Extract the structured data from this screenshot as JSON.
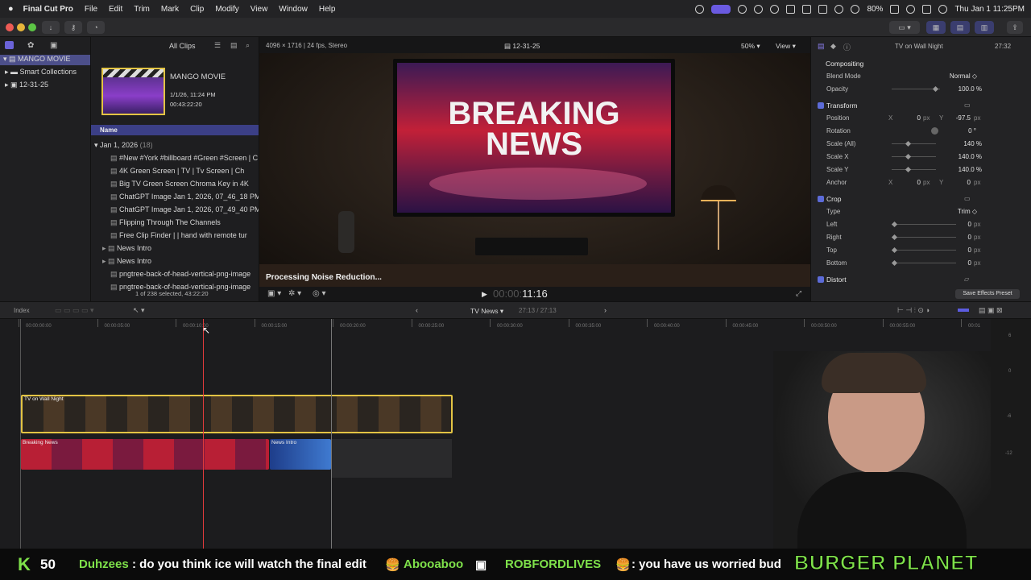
{
  "menubar": {
    "app": "Final Cut Pro",
    "items": [
      "File",
      "Edit",
      "Trim",
      "Mark",
      "Clip",
      "Modify",
      "View",
      "Window",
      "Help"
    ],
    "battery": "80%",
    "datetime": "Thu Jan 1  11:25PM"
  },
  "library": {
    "root": "MANGO MOVIE",
    "items": [
      "Smart Collections",
      "12-31-25"
    ]
  },
  "browser": {
    "filter": "All Clips",
    "project_title": "MANGO MOVIE",
    "project_date": "1/1/26, 11:24 PM",
    "project_duration": "00:43:22:20",
    "column": "Name",
    "group": "Jan 1, 2026",
    "group_count": "(18)",
    "clips": [
      "#New #York #billboard #Green #Screen | C",
      "4K Green Screen  |  TV  |  Tv Screen  |  Ch",
      "Big TV Green Screen Chroma Key in 4K",
      "ChatGPT Image Jan 1, 2026, 07_46_18 PM",
      "ChatGPT Image Jan 1, 2026, 07_49_40 PM",
      "Flipping Through The Channels",
      "Free Clip Finder  |  |  hand with remote tur",
      "News Intro",
      "News Intro",
      "pngtree-back-of-head-vertical-png-image",
      "pngtree-back-of-head-vertical-png-image"
    ],
    "status": "1 of 238 selected, 43:22:20"
  },
  "viewer": {
    "format": "4096 × 1716 | 24 fps, Stereo",
    "project": "12-31-25",
    "zoom": "50%",
    "view": "View",
    "headline1": "BREAKING",
    "headline2": "NEWS",
    "processing": "Processing Noise Reduction...",
    "timecode": "11:16"
  },
  "inspector": {
    "clip": "TV on Wall Night",
    "duration": "27:32",
    "compositing": "Compositing",
    "blend_mode_label": "Blend Mode",
    "blend_mode": "Normal ◇",
    "opacity_label": "Opacity",
    "opacity": "100.0 %",
    "transform": "Transform",
    "position_label": "Position",
    "pos_x_label": "X",
    "pos_x": "0",
    "pos_y_label": "Y",
    "pos_y": "-97.5",
    "px": "px",
    "rotation_label": "Rotation",
    "rotation": "0 °",
    "scale_all_label": "Scale (All)",
    "scale_all": "140 %",
    "scale_x_label": "Scale X",
    "scale_x": "140.0 %",
    "scale_y_label": "Scale Y",
    "scale_y": "140.0 %",
    "anchor_label": "Anchor",
    "anchor_x_label": "X",
    "anchor_x": "0",
    "anchor_y_label": "Y",
    "anchor_y": "0",
    "crop": "Crop",
    "type_label": "Type",
    "type": "Trim ◇",
    "left_label": "Left",
    "left": "0",
    "right_label": "Right",
    "right": "0",
    "top_label": "Top",
    "top": "0",
    "bottom_label": "Bottom",
    "bottom": "0",
    "distort": "Distort",
    "save_preset": "Save Effects Preset"
  },
  "timeline": {
    "index": "Index",
    "project": "TV News",
    "duration": "27:13 / 27:13",
    "ticks": [
      "00:00:00:00",
      "00:00:05:00",
      "00:00:10:00",
      "00:00:15:00",
      "00:00:20:00",
      "00:00:25:00",
      "00:00:30:00",
      "00:00:35:00",
      "00:00:40:00",
      "00:00:45:00",
      "00:00:50:00",
      "00:00:55:00",
      "00:01"
    ],
    "clip_upper": "TV on Wall Night",
    "clip_lower1": "Breaking News",
    "clip_lower2": "News Intro",
    "meter_labels": [
      "6",
      "0",
      "-6",
      "-12"
    ]
  },
  "ticker": {
    "logo": "K",
    "count": "50",
    "user1": "Duhzees",
    "msg1": ": do you think ice will watch the final edit",
    "user2": "Abooaboo",
    "user3": "ROBFORDLIVES",
    "msg3": ": you have us worried bud",
    "brand": "BURGER PLANET"
  },
  "colors": {
    "accent": "#5c5ce0",
    "playhead": "#e23b3b",
    "clip_yellow": "#e3c444",
    "brand": "#7ee04a"
  }
}
